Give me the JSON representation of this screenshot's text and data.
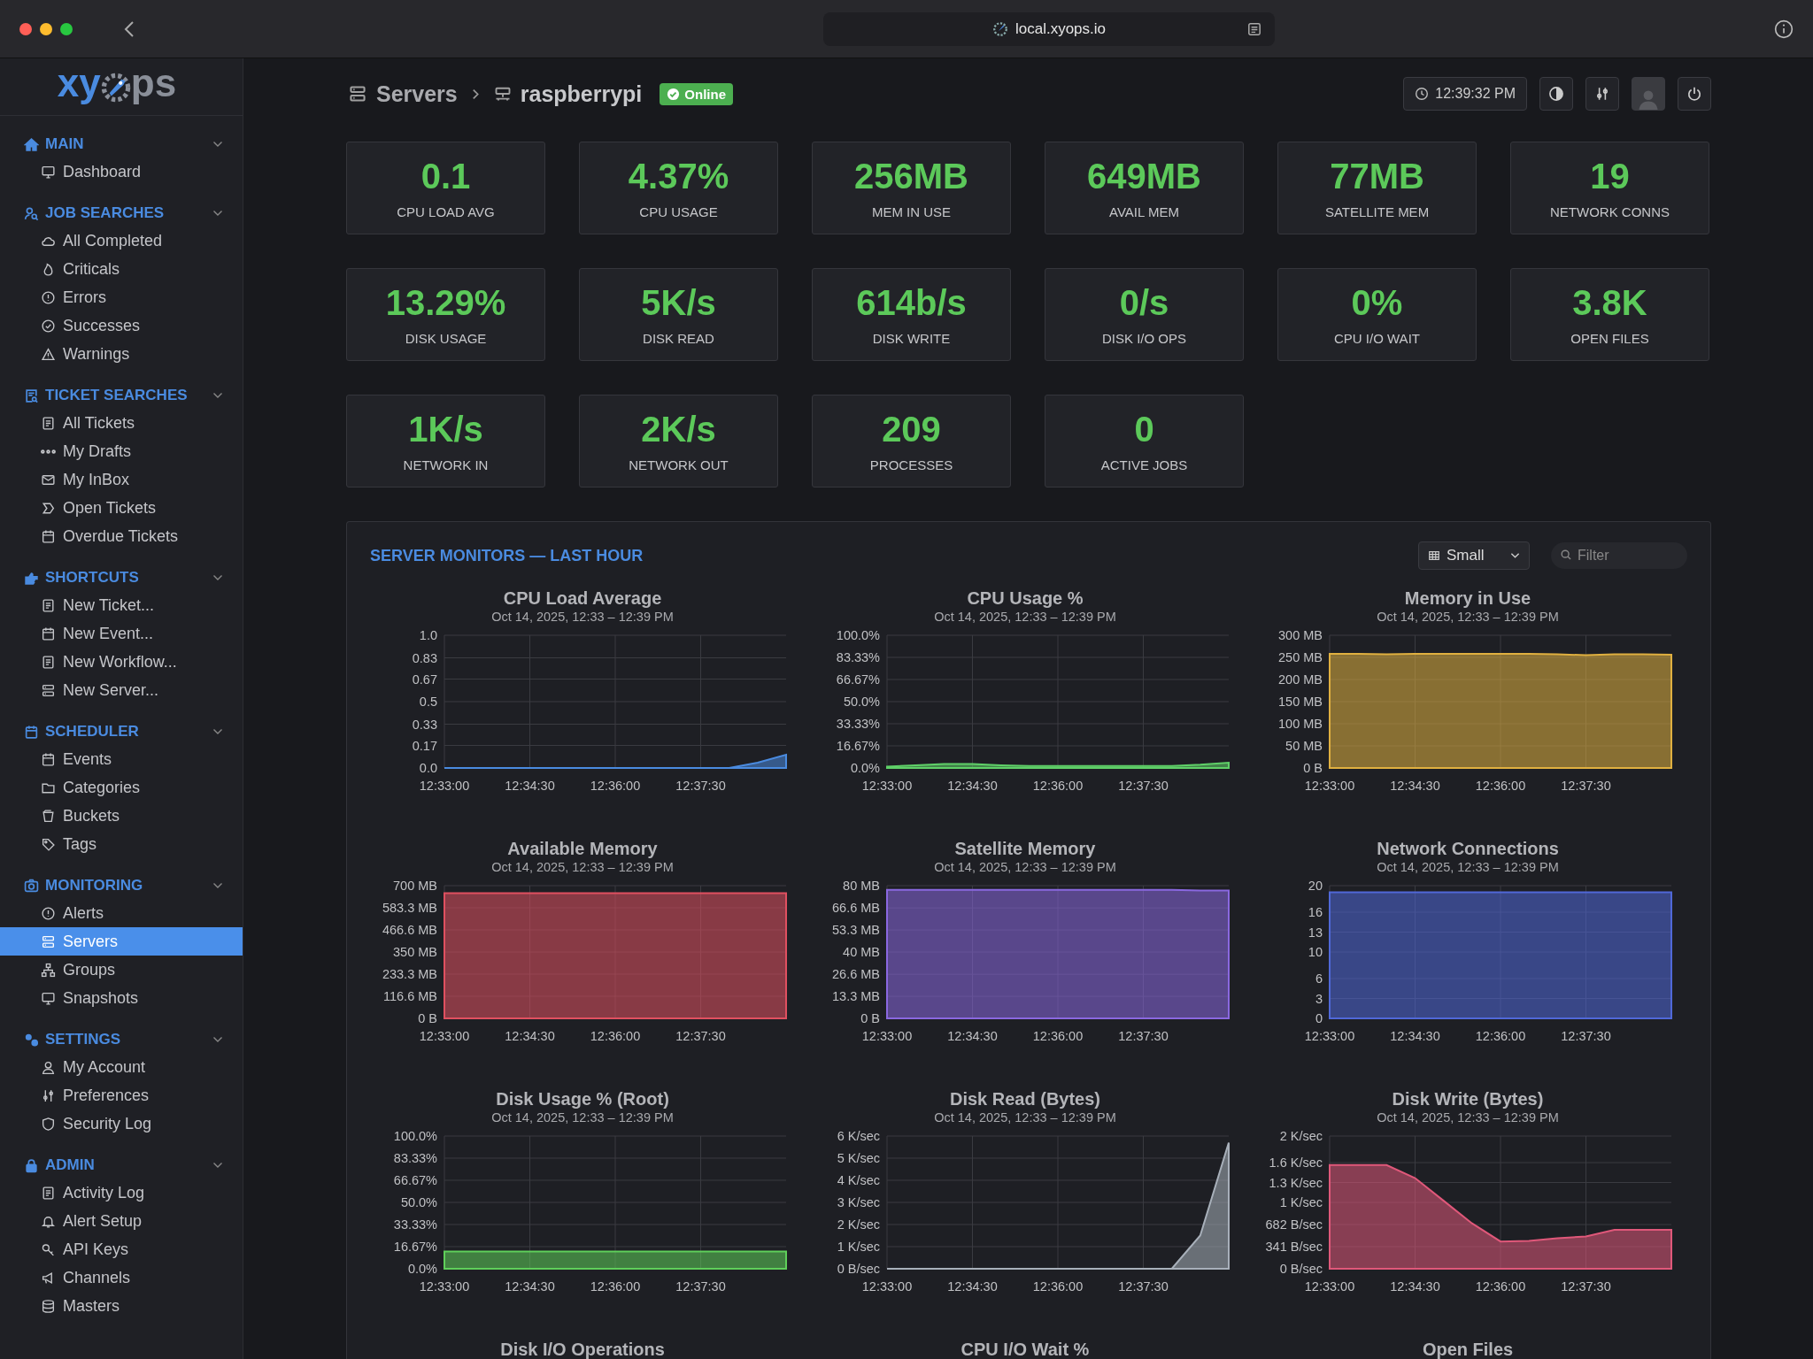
{
  "window": {
    "url": "local.xyops.io"
  },
  "sidebar": {
    "logo": {
      "left": "xy",
      "right": "ps"
    },
    "sections": [
      {
        "title": "MAIN",
        "items": [
          {
            "label": "Dashboard",
            "selected": false
          }
        ]
      },
      {
        "title": "JOB SEARCHES",
        "items": [
          {
            "label": "All Completed",
            "selected": false
          },
          {
            "label": "Criticals",
            "selected": false
          },
          {
            "label": "Errors",
            "selected": false
          },
          {
            "label": "Successes",
            "selected": false
          },
          {
            "label": "Warnings",
            "selected": false
          }
        ]
      },
      {
        "title": "TICKET SEARCHES",
        "items": [
          {
            "label": "All Tickets",
            "selected": false
          },
          {
            "label": "My Drafts",
            "selected": false
          },
          {
            "label": "My InBox",
            "selected": false
          },
          {
            "label": "Open Tickets",
            "selected": false
          },
          {
            "label": "Overdue Tickets",
            "selected": false
          }
        ]
      },
      {
        "title": "SHORTCUTS",
        "items": [
          {
            "label": "New Ticket...",
            "selected": false
          },
          {
            "label": "New Event...",
            "selected": false
          },
          {
            "label": "New Workflow...",
            "selected": false
          },
          {
            "label": "New Server...",
            "selected": false
          }
        ]
      },
      {
        "title": "SCHEDULER",
        "items": [
          {
            "label": "Events",
            "selected": false
          },
          {
            "label": "Categories",
            "selected": false
          },
          {
            "label": "Buckets",
            "selected": false
          },
          {
            "label": "Tags",
            "selected": false
          }
        ]
      },
      {
        "title": "MONITORING",
        "items": [
          {
            "label": "Alerts",
            "selected": false
          },
          {
            "label": "Servers",
            "selected": true
          },
          {
            "label": "Groups",
            "selected": false
          },
          {
            "label": "Snapshots",
            "selected": false
          }
        ]
      },
      {
        "title": "SETTINGS",
        "items": [
          {
            "label": "My Account",
            "selected": false
          },
          {
            "label": "Preferences",
            "selected": false
          },
          {
            "label": "Security Log",
            "selected": false
          }
        ]
      },
      {
        "title": "ADMIN",
        "items": [
          {
            "label": "Activity Log",
            "selected": false
          },
          {
            "label": "Alert Setup",
            "selected": false
          },
          {
            "label": "API Keys",
            "selected": false
          },
          {
            "label": "Channels",
            "selected": false
          },
          {
            "label": "Masters",
            "selected": false
          }
        ]
      }
    ]
  },
  "header": {
    "breadcrumb": [
      "Servers",
      "raspberrypi"
    ],
    "status": "Online",
    "time": "12:39:32 PM"
  },
  "stats": [
    {
      "value": "0.1",
      "label": "CPU LOAD AVG"
    },
    {
      "value": "4.37%",
      "label": "CPU USAGE"
    },
    {
      "value": "256MB",
      "label": "MEM IN USE"
    },
    {
      "value": "649MB",
      "label": "AVAIL MEM"
    },
    {
      "value": "77MB",
      "label": "SATELLITE MEM"
    },
    {
      "value": "19",
      "label": "NETWORK CONNS"
    },
    {
      "value": "13.29%",
      "label": "DISK USAGE"
    },
    {
      "value": "5K/s",
      "label": "DISK READ"
    },
    {
      "value": "614b/s",
      "label": "DISK WRITE"
    },
    {
      "value": "0/s",
      "label": "DISK I/O OPS"
    },
    {
      "value": "0%",
      "label": "CPU I/O WAIT"
    },
    {
      "value": "3.8K",
      "label": "OPEN FILES"
    },
    {
      "value": "1K/s",
      "label": "NETWORK IN"
    },
    {
      "value": "2K/s",
      "label": "NETWORK OUT"
    },
    {
      "value": "209",
      "label": "PROCESSES"
    },
    {
      "value": "0",
      "label": "ACTIVE JOBS"
    }
  ],
  "monitors": {
    "title": "SERVER MONITORS — LAST HOUR",
    "size": "Small",
    "filter_placeholder": "Filter",
    "charts": [
      {
        "subtitle": "Oct 14, 2025, 12:33 – 12:39 PM",
        "chart_data": {
          "type": "area",
          "grid": true,
          "title": "CPU Load Average",
          "categories": [
            "12:33:00",
            null,
            null,
            "12:34:30",
            null,
            null,
            "12:36:00",
            null,
            null,
            "12:37:30",
            null,
            null,
            null
          ],
          "ylim": [
            0,
            1
          ],
          "yticks": [
            {
              "value": 0,
              "label": "0.0"
            },
            0.17,
            0.33,
            0.5,
            0.67,
            0.83,
            {
              "value": 1,
              "label": "1.0"
            }
          ],
          "series": [
            {
              "color": "#4a8be0",
              "values": [
                0,
                0,
                0,
                0,
                0,
                0,
                0,
                0,
                0,
                0,
                0,
                0.04,
                0.1
              ]
            }
          ]
        }
      },
      {
        "subtitle": "Oct 14, 2025, 12:33 – 12:39 PM",
        "chart_data": {
          "type": "area",
          "grid": true,
          "title": "CPU Usage %",
          "categories": [
            "12:33:00",
            null,
            null,
            "12:34:30",
            null,
            null,
            "12:36:00",
            null,
            null,
            "12:37:30",
            null,
            null,
            null
          ],
          "ylim": [
            0,
            100
          ],
          "yticks": [
            {
              "value": 0,
              "label": "0.0%"
            },
            {
              "value": 16.67,
              "label": "16.67%"
            },
            {
              "value": 33.33,
              "label": "33.33%"
            },
            {
              "value": 50,
              "label": "50.0%"
            },
            {
              "value": 66.67,
              "label": "66.67%"
            },
            {
              "value": 83.33,
              "label": "83.33%"
            },
            {
              "value": 100,
              "label": "100.0%"
            }
          ],
          "series": [
            {
              "color": "#5fd068",
              "values": [
                1,
                2,
                3,
                3,
                2,
                1.5,
                1.5,
                1.5,
                1.5,
                1.5,
                1.5,
                2.5,
                4
              ]
            }
          ]
        }
      },
      {
        "subtitle": "Oct 14, 2025, 12:33 – 12:39 PM",
        "chart_data": {
          "type": "area",
          "grid": true,
          "title": "Memory in Use",
          "categories": [
            "12:33:00",
            null,
            null,
            "12:34:30",
            null,
            null,
            "12:36:00",
            null,
            null,
            "12:37:30",
            null,
            null,
            null
          ],
          "ylim": [
            0,
            300
          ],
          "yticks": [
            {
              "value": 0,
              "label": "0 B"
            },
            {
              "value": 50,
              "label": "50 MB"
            },
            {
              "value": 100,
              "label": "100 MB"
            },
            {
              "value": 150,
              "label": "150 MB"
            },
            {
              "value": 200,
              "label": "200 MB"
            },
            {
              "value": 250,
              "label": "250 MB"
            },
            {
              "value": 300,
              "label": "300 MB"
            }
          ],
          "series": [
            {
              "color": "#e0b040",
              "values": [
                258,
                258,
                257,
                258,
                258,
                258,
                258,
                258,
                257,
                255,
                257,
                257,
                256
              ]
            }
          ]
        }
      },
      {
        "subtitle": "Oct 14, 2025, 12:33 – 12:39 PM",
        "chart_data": {
          "type": "area",
          "grid": true,
          "title": "Available Memory",
          "categories": [
            "12:33:00",
            null,
            null,
            "12:34:30",
            null,
            null,
            "12:36:00",
            null,
            null,
            "12:37:30",
            null,
            null,
            null
          ],
          "ylim": [
            0,
            700
          ],
          "yticks": [
            {
              "value": 0,
              "label": "0 B"
            },
            {
              "value": 116.6,
              "label": "116.6 MB"
            },
            {
              "value": 233.3,
              "label": "233.3 MB"
            },
            {
              "value": 350,
              "label": "350 MB"
            },
            {
              "value": 466.6,
              "label": "466.6 MB"
            },
            {
              "value": 583.3,
              "label": "583.3 MB"
            },
            {
              "value": 700,
              "label": "700 MB"
            }
          ],
          "series": [
            {
              "color": "#e05060",
              "values": [
                660,
                660,
                660,
                660,
                660,
                660,
                660,
                660,
                660,
                660,
                660,
                660,
                660
              ]
            }
          ]
        }
      },
      {
        "subtitle": "Oct 14, 2025, 12:33 – 12:39 PM",
        "chart_data": {
          "type": "area",
          "grid": true,
          "title": "Satellite Memory",
          "categories": [
            "12:33:00",
            null,
            null,
            "12:34:30",
            null,
            null,
            "12:36:00",
            null,
            null,
            "12:37:30",
            null,
            null,
            null
          ],
          "ylim": [
            0,
            80
          ],
          "yticks": [
            {
              "value": 0,
              "label": "0 B"
            },
            {
              "value": 13.3,
              "label": "13.3 MB"
            },
            {
              "value": 26.6,
              "label": "26.6 MB"
            },
            {
              "value": 40,
              "label": "40 MB"
            },
            {
              "value": 53.3,
              "label": "53.3 MB"
            },
            {
              "value": 66.6,
              "label": "66.6 MB"
            },
            {
              "value": 80,
              "label": "80 MB"
            }
          ],
          "series": [
            {
              "color": "#8a68e0",
              "values": [
                77.5,
                77.5,
                77.5,
                77.5,
                77.5,
                77.5,
                77.5,
                77.5,
                77.5,
                77.5,
                77.5,
                77,
                77
              ]
            }
          ]
        }
      },
      {
        "subtitle": "Oct 14, 2025, 12:33 – 12:39 PM",
        "chart_data": {
          "type": "area",
          "grid": true,
          "title": "Network Connections",
          "categories": [
            "12:33:00",
            null,
            null,
            "12:34:30",
            null,
            null,
            "12:36:00",
            null,
            null,
            "12:37:30",
            null,
            null,
            null
          ],
          "ylim": [
            0,
            20
          ],
          "yticks": [
            0,
            3,
            6,
            10,
            13,
            16,
            20
          ],
          "series": [
            {
              "color": "#5068d8",
              "values": [
                19,
                19,
                19,
                19,
                19,
                19,
                19,
                19,
                19,
                19,
                19,
                19,
                19
              ]
            }
          ]
        }
      },
      {
        "subtitle": "Oct 14, 2025, 12:33 – 12:39 PM",
        "chart_data": {
          "type": "area",
          "grid": true,
          "title": "Disk Usage % (Root)",
          "categories": [
            "12:33:00",
            null,
            null,
            "12:34:30",
            null,
            null,
            "12:36:00",
            null,
            null,
            "12:37:30",
            null,
            null,
            null
          ],
          "ylim": [
            0,
            100
          ],
          "yticks": [
            {
              "value": 0,
              "label": "0.0%"
            },
            {
              "value": 16.67,
              "label": "16.67%"
            },
            {
              "value": 33.33,
              "label": "33.33%"
            },
            {
              "value": 50,
              "label": "50.0%"
            },
            {
              "value": 66.67,
              "label": "66.67%"
            },
            {
              "value": 83.33,
              "label": "83.33%"
            },
            {
              "value": 100,
              "label": "100.0%"
            }
          ],
          "series": [
            {
              "color": "#5fcf5a",
              "values": [
                13,
                13,
                13,
                13,
                13,
                13,
                13,
                13,
                13,
                13,
                13,
                13,
                13
              ]
            }
          ]
        }
      },
      {
        "subtitle": "Oct 14, 2025, 12:33 – 12:39 PM",
        "chart_data": {
          "type": "area",
          "grid": true,
          "title": "Disk Read (Bytes)",
          "categories": [
            "12:33:00",
            null,
            null,
            "12:34:30",
            null,
            null,
            "12:36:00",
            null,
            null,
            "12:37:30",
            null,
            null,
            null
          ],
          "ylim": [
            0,
            6
          ],
          "yticks": [
            {
              "value": 0,
              "label": "0 B/sec"
            },
            {
              "value": 1,
              "label": "1 K/sec"
            },
            {
              "value": 2,
              "label": "2 K/sec"
            },
            {
              "value": 3,
              "label": "3 K/sec"
            },
            {
              "value": 4,
              "label": "4 K/sec"
            },
            {
              "value": 5,
              "label": "5 K/sec"
            },
            {
              "value": 6,
              "label": "6 K/sec"
            }
          ],
          "series": [
            {
              "color": "#a8b0ba",
              "values": [
                0,
                0,
                0,
                0,
                0,
                0,
                0,
                0,
                0,
                0,
                0,
                1.5,
                5.7
              ]
            }
          ]
        }
      },
      {
        "subtitle": "Oct 14, 2025, 12:33 – 12:39 PM",
        "chart_data": {
          "type": "area",
          "grid": true,
          "title": "Disk Write (Bytes)",
          "categories": [
            "12:33:00",
            null,
            null,
            "12:34:30",
            null,
            null,
            "12:36:00",
            null,
            null,
            "12:37:30",
            null,
            null,
            null
          ],
          "ylim": [
            0,
            2048
          ],
          "yticks": [
            {
              "value": 0,
              "label": "0 B/sec"
            },
            {
              "value": 341,
              "label": "341 B/sec"
            },
            {
              "value": 682,
              "label": "682 B/sec"
            },
            {
              "value": 1024,
              "label": "1 K/sec"
            },
            {
              "value": 1331,
              "label": "1.3 K/sec"
            },
            {
              "value": 1638,
              "label": "1.6 K/sec"
            },
            {
              "value": 2048,
              "label": "2 K/sec"
            }
          ],
          "series": [
            {
              "color": "#e0587a",
              "values": [
                1600,
                1600,
                1600,
                1400,
                1050,
                700,
                420,
                430,
                470,
                500,
                600,
                600,
                600
              ]
            }
          ]
        }
      }
    ],
    "more_charts": [
      {
        "title": "Disk I/O Operations"
      },
      {
        "title": "CPU I/O Wait %"
      },
      {
        "title": "Open Files"
      }
    ]
  }
}
